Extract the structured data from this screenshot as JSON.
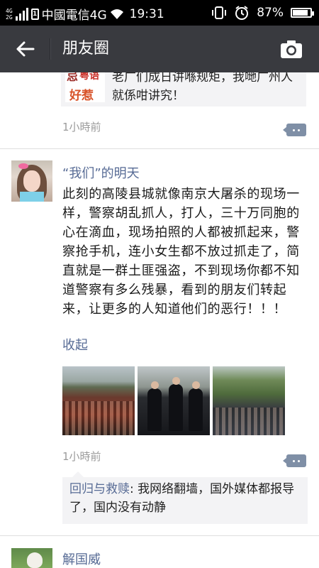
{
  "status_bar": {
    "network_small": [
      "4G",
      "2G"
    ],
    "carrier": "中國電信4G",
    "time": "19:31",
    "battery_percent": "87%",
    "battery_level": 0.87
  },
  "header": {
    "title": "朋友圈",
    "back_icon": "back-arrow-icon",
    "camera_icon": "camera-icon"
  },
  "feed": {
    "prev_post": {
      "shared_thumb_text": [
        "忌",
        "粤语",
        "好惹"
      ],
      "shared_text": "老广们成日讲喺规矩，我哋广州人就係咁讲究！",
      "time": "1小時前"
    },
    "post": {
      "author": "“我们”的明天",
      "text": "此刻的高陵县城就像南京大屠杀的现场一样，警察胡乱抓人，打人，三十万同胞的心在滴血，现场拍照的人都被抓起来，警察抢手机，连小女生都不放过抓走了，简直就是一群土匪强盗，不到现场你都不知道警察有多么残暴，看到的朋友们转起来，让更多的人知道他们的恶行！！！",
      "collapse_label": "收起",
      "time": "1小時前",
      "comments": [
        {
          "user": "回归与救赎",
          "sep": ": ",
          "text": "我网络翻墙，国外媒体都报导了，国内没有动静"
        }
      ]
    },
    "next_post": {
      "author": "解国威"
    }
  }
}
